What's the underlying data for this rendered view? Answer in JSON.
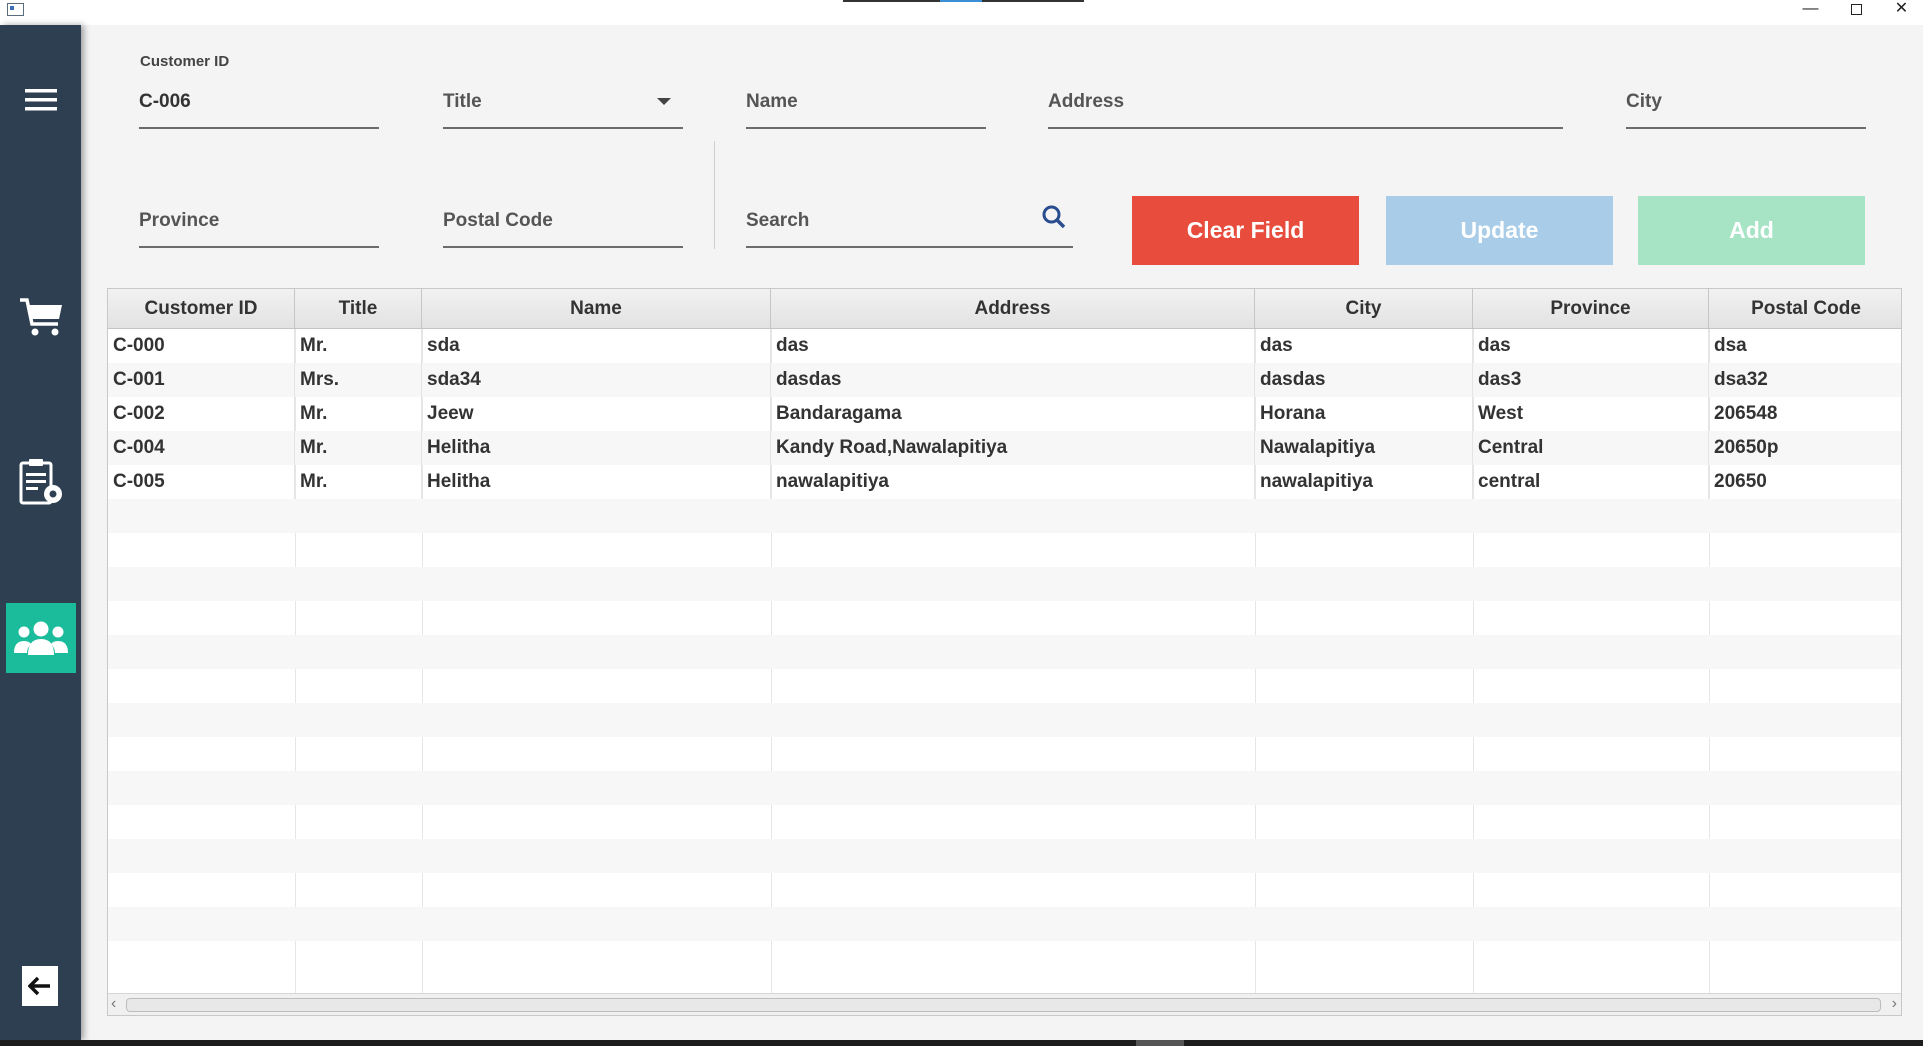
{
  "window": {
    "minimize_icon": "minimize-icon",
    "maximize_icon": "maximize-icon",
    "close_icon": "close-icon",
    "minimize_glyph": "—",
    "close_glyph": "✕"
  },
  "sidebar": {
    "items": [
      {
        "name": "menu",
        "icon": "hamburger-icon"
      },
      {
        "name": "orders",
        "icon": "cart-icon"
      },
      {
        "name": "manage",
        "icon": "clipboard-gear-icon"
      },
      {
        "name": "customers",
        "icon": "users-icon",
        "active": true
      },
      {
        "name": "back",
        "icon": "arrow-left-icon"
      }
    ],
    "active_color": "#1bbc9b",
    "background": "#2e3f51"
  },
  "form": {
    "customer_id": {
      "label": "Customer ID",
      "value": "C-006"
    },
    "title": {
      "placeholder": "Title"
    },
    "name": {
      "placeholder": "Name"
    },
    "address": {
      "placeholder": "Address"
    },
    "city": {
      "placeholder": "City"
    },
    "province": {
      "placeholder": "Province"
    },
    "postal_code": {
      "placeholder": "Postal Code"
    },
    "search": {
      "placeholder": "Search"
    }
  },
  "buttons": {
    "clear": "Clear Field",
    "update": "Update",
    "add": "Add"
  },
  "colors": {
    "clear": "#e74c3c",
    "update_disabled": "#a9cde8",
    "add_disabled": "#a7e4c6"
  },
  "table": {
    "columns": [
      "Customer ID",
      "Title",
      "Name",
      "Address",
      "City",
      "Province",
      "Postal Code"
    ],
    "rows": [
      [
        "C-000",
        "Mr.",
        "sda",
        "das",
        "das",
        "das",
        "dsa"
      ],
      [
        "C-001",
        "Mrs.",
        "sda34",
        "dasdas",
        "dasdas",
        "das3",
        "dsa32"
      ],
      [
        "C-002",
        "Mr.",
        "Jeew",
        "Bandaragama",
        "Horana",
        "West",
        "206548"
      ],
      [
        "C-004",
        "Mr.",
        "Helitha",
        "Kandy Road,Nawalapitiya",
        "Nawalapitiya",
        "Central",
        "20650p"
      ],
      [
        "C-005",
        "Mr.",
        "Helitha",
        "nawalapitiya",
        "nawalapitiya",
        "central",
        "20650"
      ]
    ]
  }
}
